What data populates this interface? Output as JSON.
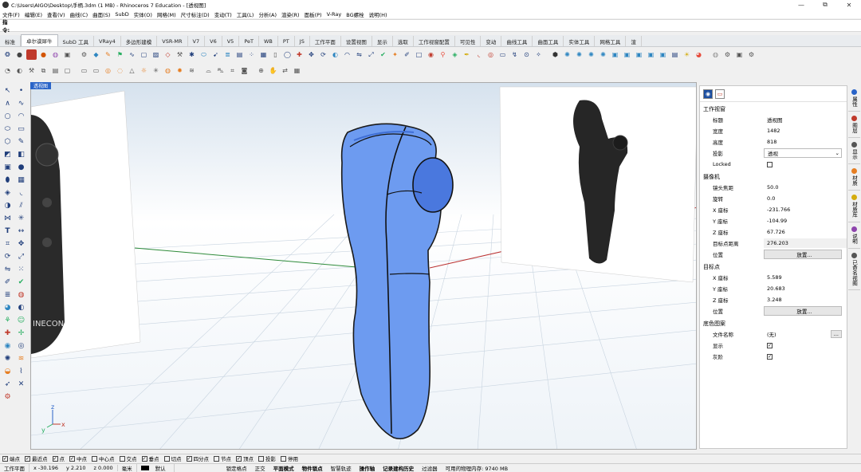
{
  "window": {
    "title": "C:\\Users\\AIGO\\Desktop\\手柄.3dm (1 MB) - Rhinoceros 7 Education - [透视图]",
    "controls": [
      "—",
      "⧉",
      "✕"
    ]
  },
  "menu": [
    "文件(F)",
    "编辑(E)",
    "查看(V)",
    "曲线(C)",
    "曲面(S)",
    "SubD",
    "实体(O)",
    "网格(M)",
    "尺寸标注(D)",
    "变动(T)",
    "工具(L)",
    "分析(A)",
    "渲染(R)",
    "面板(P)",
    "V-Ray",
    "BG螺栓",
    "说明(H)"
  ],
  "command": {
    "label": "指令:",
    "value": ""
  },
  "tabs": [
    "标准",
    "卓尔谟犀牛",
    "SubD 工具",
    "VRay4",
    "多边形建模",
    "VSR-MR",
    "V7",
    "V6",
    "V5",
    "PeT",
    "WB",
    "PT",
    "JS",
    "工作平面",
    "设置视图",
    "显示",
    "选取",
    "工作视窗配置",
    "可见性",
    "变动",
    "曲线工具",
    "曲面工具",
    "实体工具",
    "网格工具",
    "渲"
  ],
  "active_tab": "卓尔谟犀牛",
  "viewport": {
    "label": "透视图",
    "axis": {
      "x": "x",
      "y": "y",
      "z": "z"
    },
    "left_image_text": "INECON"
  },
  "panel": {
    "section_viewport": "工作视窗",
    "viewport_rows": [
      {
        "k": "标题",
        "v": "透视图"
      },
      {
        "k": "宽度",
        "v": "1482"
      },
      {
        "k": "高度",
        "v": "818"
      },
      {
        "k": "投影",
        "v": "透视"
      },
      {
        "k": "Locked",
        "v": ""
      }
    ],
    "section_camera": "摄像机",
    "camera_rows": [
      {
        "k": "镜头焦距",
        "v": "50.0"
      },
      {
        "k": "旋转",
        "v": "0.0"
      },
      {
        "k": "X 座标",
        "v": "-231.766"
      },
      {
        "k": "Y 座标",
        "v": "-104.99"
      },
      {
        "k": "Z 座标",
        "v": "67.726"
      },
      {
        "k": "目标点距离",
        "v": "276.203"
      },
      {
        "k": "位置",
        "v": "放置..."
      }
    ],
    "section_target": "目标点",
    "target_rows": [
      {
        "k": "X 座标",
        "v": "5.589"
      },
      {
        "k": "Y 座标",
        "v": "20.683"
      },
      {
        "k": "Z 座标",
        "v": "3.248"
      },
      {
        "k": "位置",
        "v": "放置..."
      }
    ],
    "section_wallpaper": "底色图案",
    "wallpaper_rows": [
      {
        "k": "文件名称",
        "v": "(无)"
      },
      {
        "k": "显示",
        "v": "✓"
      },
      {
        "k": "灰阶",
        "v": "✓"
      }
    ],
    "filename_btn": "..."
  },
  "side_tabs": [
    "属性",
    "图层",
    "显示",
    "材质",
    "材质库",
    "说明",
    "已命名视图"
  ],
  "osnap": [
    {
      "label": "端点",
      "checked": true
    },
    {
      "label": "最近点",
      "checked": true
    },
    {
      "label": "点",
      "checked": true
    },
    {
      "label": "中点",
      "checked": true
    },
    {
      "label": "中心点",
      "checked": false
    },
    {
      "label": "交点",
      "checked": false
    },
    {
      "label": "垂点",
      "checked": true
    },
    {
      "label": "切点",
      "checked": false
    },
    {
      "label": "四分点",
      "checked": true
    },
    {
      "label": "节点",
      "checked": false
    },
    {
      "label": "顶点",
      "checked": true
    },
    {
      "label": "投影",
      "checked": false
    },
    {
      "label": "停用",
      "checked": false
    }
  ],
  "status": {
    "plane": "工作平面",
    "x": "x -30.196",
    "y": "y 2.210",
    "z": "z 0.000",
    "unit": "毫米",
    "layer": "默认",
    "items": [
      "锁定格点",
      "正交",
      "平面模式",
      "物件锁点",
      "智慧轨迹",
      "操作轴",
      "记录建构历史",
      "过滤器"
    ],
    "memory": "可用的物理内存: 9740 MB"
  },
  "colors": {
    "accent": "#2a64c8",
    "model_blue": "#6d9bf0"
  }
}
